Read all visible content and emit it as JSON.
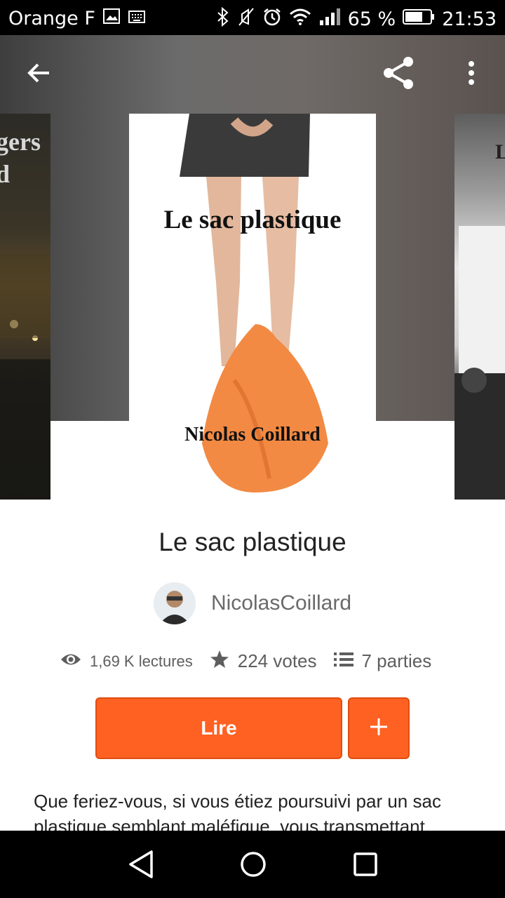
{
  "status_bar": {
    "carrier": "Orange F",
    "battery_percent": "65 %",
    "time": "21:53",
    "icons": [
      "image-icon",
      "keyboard-icon",
      "bluetooth-icon",
      "mute-icon",
      "alarm-icon",
      "wifi-icon",
      "signal-icon",
      "battery-icon"
    ]
  },
  "cover": {
    "title": "Le sac plastique",
    "author": "Nicolas Coillard"
  },
  "left_cover_text": "gers\nd",
  "right_cover_text": "L",
  "book": {
    "title": "Le sac plastique",
    "author_name": "NicolasCoillard"
  },
  "stats": {
    "reads": "1,69 K lectures",
    "votes": "224 votes",
    "parts": "7 parties"
  },
  "actions": {
    "read_label": "Lire",
    "add_label": "+"
  },
  "description": "Que feriez-vous, si vous étiez poursuivi par un sac plastique semblant maléfique, vous transmettant..."
}
